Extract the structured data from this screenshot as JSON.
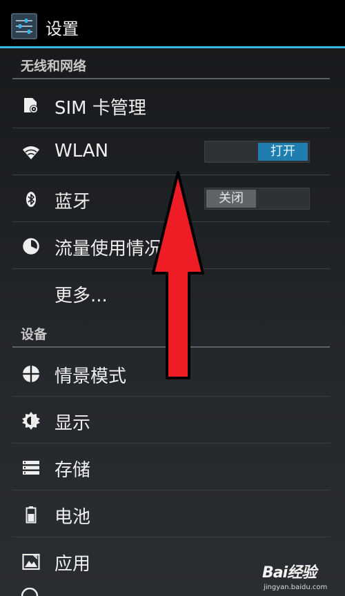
{
  "app": {
    "title": "设置",
    "icon": "settings-sliders-icon"
  },
  "sections": {
    "wireless": "无线和网络",
    "device": "设备"
  },
  "rows": {
    "sim": {
      "label": "SIM 卡管理",
      "icon": "sim-card-icon"
    },
    "wlan": {
      "label": "WLAN",
      "icon": "wifi-icon",
      "toggle": "打开",
      "state": "on"
    },
    "bluetooth": {
      "label": "蓝牙",
      "icon": "bluetooth-icon",
      "toggle": "关闭",
      "state": "off"
    },
    "data_usage": {
      "label": "流量使用情况",
      "icon": "data-usage-icon"
    },
    "more": {
      "label": "更多..."
    },
    "profiles": {
      "label": "情景模式",
      "icon": "profiles-icon"
    },
    "display": {
      "label": "显示",
      "icon": "display-brightness-icon"
    },
    "storage": {
      "label": "存储",
      "icon": "storage-icon"
    },
    "battery": {
      "label": "电池",
      "icon": "battery-icon"
    },
    "apps": {
      "label": "应用",
      "icon": "apps-icon"
    }
  },
  "watermark": {
    "brand": "Bai经验",
    "url": "jingyan.baidu.com"
  },
  "colors": {
    "accent": "#33b5e5",
    "toggle_on": "#1f7eaf",
    "arrow": "#ee1c25"
  }
}
